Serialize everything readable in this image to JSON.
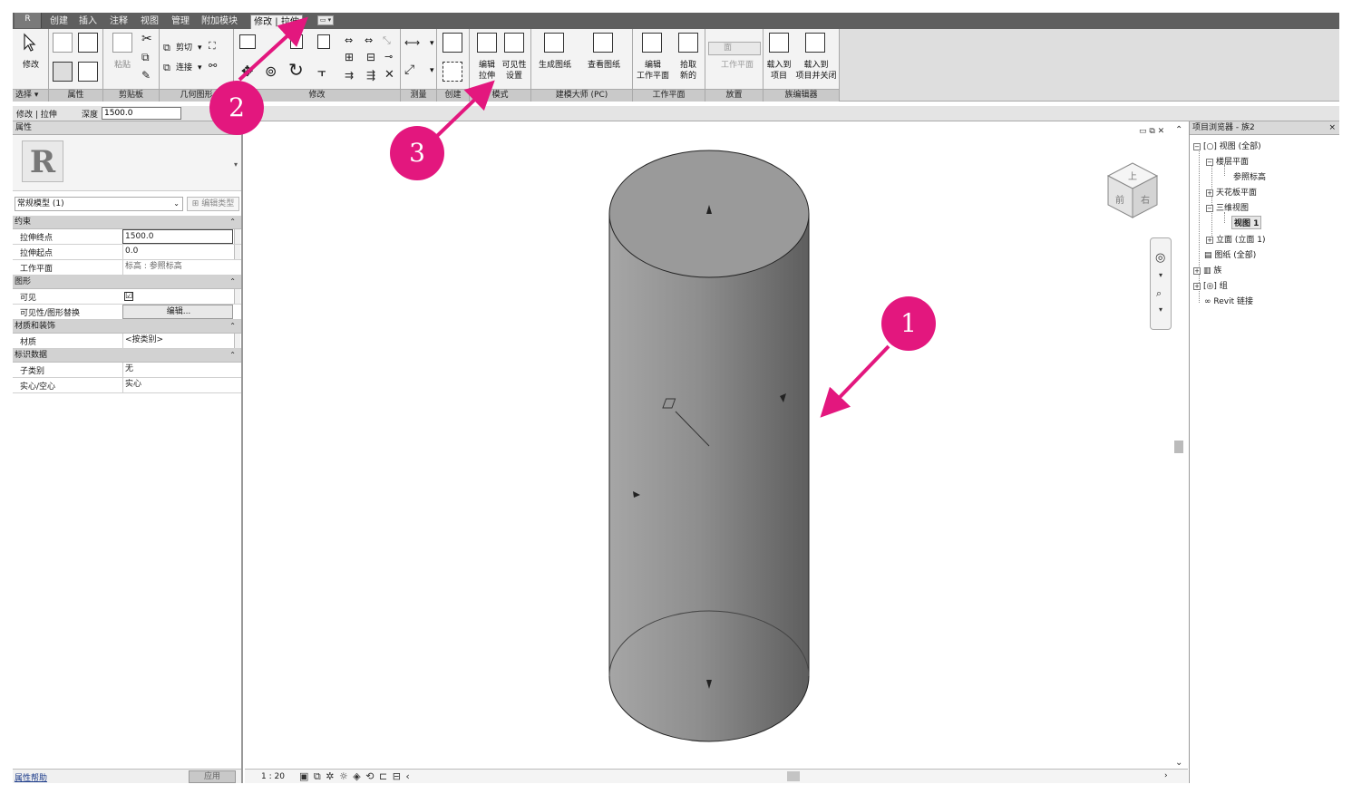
{
  "tabs": {
    "app_button": "R",
    "items": [
      "创建",
      "插入",
      "注释",
      "视图",
      "管理",
      "附加模块",
      "修改 | 拉伸"
    ],
    "extra": "▭ ▾"
  },
  "ribbon": {
    "modify_label": "修改",
    "paste_label": "粘贴",
    "cut_label": "剪切",
    "join_label": "连接",
    "edit_extrusion": "编辑\n拉伸",
    "visibility_settings": "可见性\n设置",
    "generate_drawing": "生成图纸",
    "view_drawing": "查看图纸",
    "edit_workplane": "编辑\n工作平面",
    "pick_new": "拾取\n新的",
    "face_label": "面",
    "workplane_label": "工作平面",
    "load_into_project": "载入到\n项目",
    "load_and_close": "载入到\n项目并关闭",
    "panels": [
      "选择 ▾",
      "属性",
      "剪贴板",
      "几何图形",
      "修改",
      "测量",
      "创建",
      "模式",
      "建模大师 (PC)",
      "工作平面",
      "放置",
      "族编辑器"
    ]
  },
  "options_bar": {
    "context": "修改 | 拉伸",
    "depth_label": "深度",
    "depth_value": "1500.0"
  },
  "properties": {
    "title": "属性",
    "type_selector": "常规模型 (1)",
    "edit_type": "编辑类型",
    "groups": [
      {
        "name": "约束",
        "rows": [
          {
            "key": "拉伸终点",
            "value": "1500.0"
          },
          {
            "key": "拉伸起点",
            "value": "0.0"
          },
          {
            "key": "工作平面",
            "value": "标高 : 参照标高"
          }
        ]
      },
      {
        "name": "图形",
        "rows": [
          {
            "key": "可见",
            "value": "☑"
          },
          {
            "key": "可见性/图形替换",
            "value": "编辑..."
          }
        ]
      },
      {
        "name": "材质和装饰",
        "rows": [
          {
            "key": "材质",
            "value": "<按类别>"
          }
        ]
      },
      {
        "name": "标识数据",
        "rows": [
          {
            "key": "子类别",
            "value": "无"
          },
          {
            "key": "实心/空心",
            "value": "实心"
          }
        ]
      }
    ],
    "help_link": "属性帮助",
    "apply_button": "应用"
  },
  "viewport": {
    "scale": "1 : 20",
    "view_cube": {
      "top": "上",
      "front": "前",
      "right": "右"
    }
  },
  "browser": {
    "title": "项目浏览器 - 族2",
    "close": "×",
    "nodes": [
      {
        "label": "视图 (全部)",
        "level": 0
      },
      {
        "label": "楼层平面",
        "level": 1
      },
      {
        "label": "参照标高",
        "level": 2
      },
      {
        "label": "天花板平面",
        "level": 1
      },
      {
        "label": "三维视图",
        "level": 1
      },
      {
        "label": "视图 1",
        "level": 2
      },
      {
        "label": "立面 (立面 1)",
        "level": 1
      },
      {
        "label": "图纸 (全部)",
        "level": 0
      },
      {
        "label": "族",
        "level": 0
      },
      {
        "label": "组",
        "level": 0
      },
      {
        "label": "Revit 链接",
        "level": 0
      }
    ]
  },
  "callouts": [
    "1",
    "2",
    "3"
  ],
  "colors": {
    "callout": "#e3177e",
    "cylinder": "#8d8d8d"
  }
}
